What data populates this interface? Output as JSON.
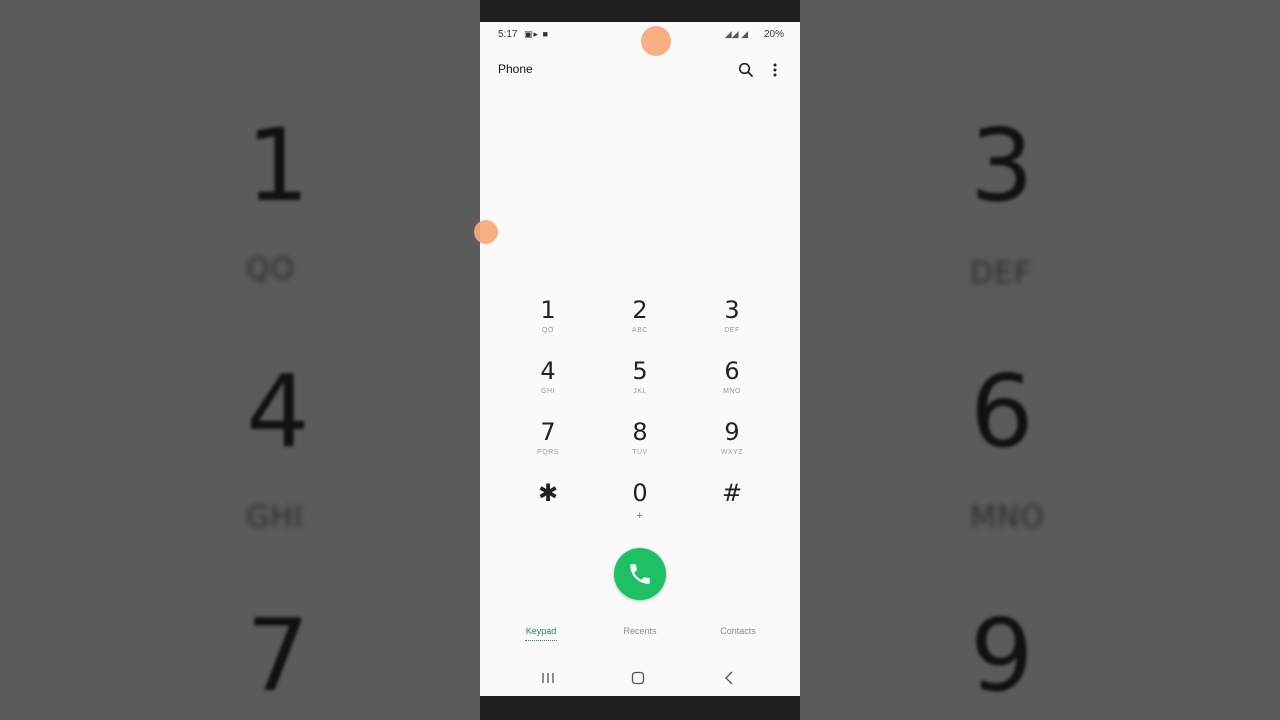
{
  "status": {
    "time": "5:17",
    "battery": "20%"
  },
  "app": {
    "title": "Phone"
  },
  "keys": [
    {
      "digit": "1",
      "letters": "QO"
    },
    {
      "digit": "2",
      "letters": "ABC"
    },
    {
      "digit": "3",
      "letters": "DEF"
    },
    {
      "digit": "4",
      "letters": "GHI"
    },
    {
      "digit": "5",
      "letters": "JKL"
    },
    {
      "digit": "6",
      "letters": "MNO"
    },
    {
      "digit": "7",
      "letters": "PQRS"
    },
    {
      "digit": "8",
      "letters": "TUV"
    },
    {
      "digit": "9",
      "letters": "WXYZ"
    },
    {
      "digit": "✱",
      "letters": ""
    },
    {
      "digit": "0",
      "letters": "+"
    },
    {
      "digit": "#",
      "letters": ""
    }
  ],
  "tabs": [
    {
      "label": "Keypad"
    },
    {
      "label": "Recents"
    },
    {
      "label": "Contacts"
    }
  ],
  "background": {
    "left": [
      {
        "glyph": "1",
        "sub": "QO"
      },
      {
        "glyph": "4",
        "sub": "GHI"
      },
      {
        "glyph": "7",
        "sub": ""
      }
    ],
    "right": [
      {
        "glyph": "3",
        "sub": "DEF"
      },
      {
        "glyph": "6",
        "sub": "MNO"
      },
      {
        "glyph": "9",
        "sub": ""
      }
    ]
  },
  "colors": {
    "call": "#1ec065",
    "accent": "#1b8a5a",
    "touch_indicator": "#f6a978"
  }
}
